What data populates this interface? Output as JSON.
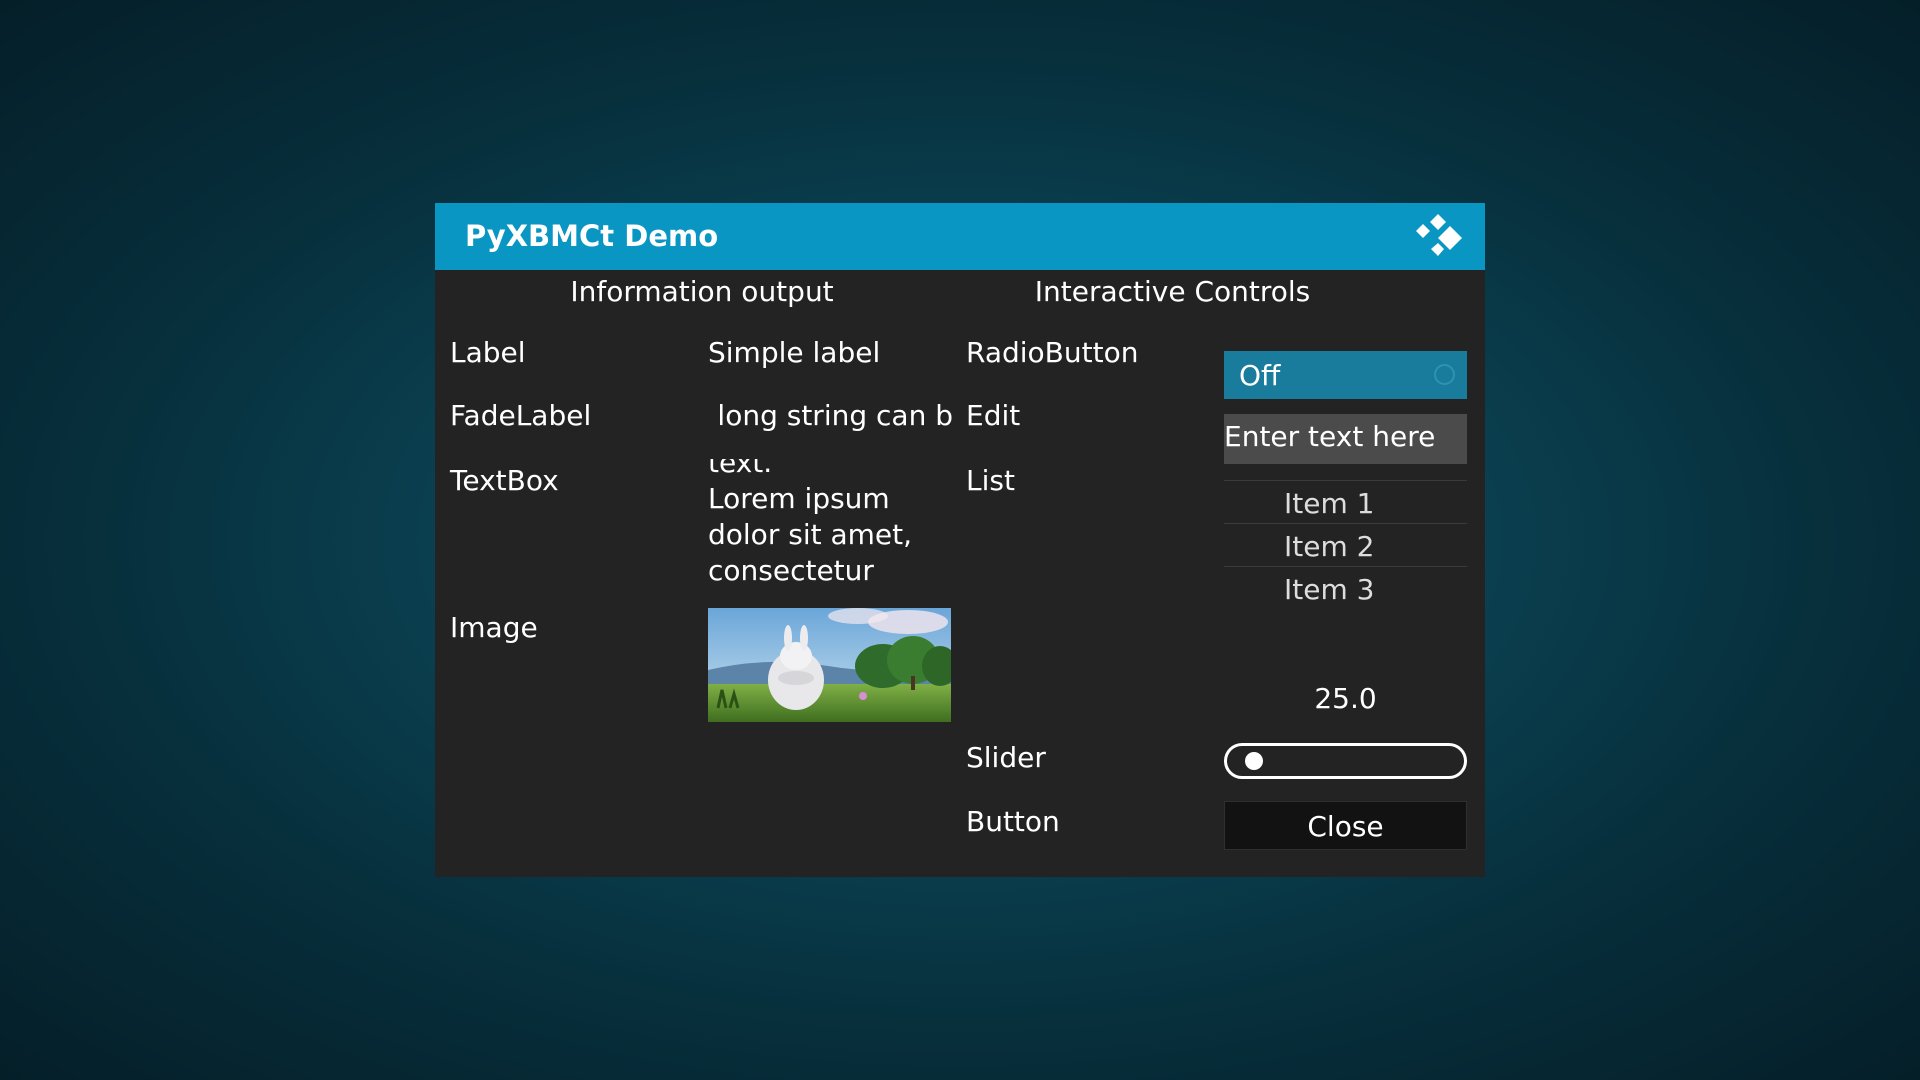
{
  "dialog": {
    "title": "PyXBMCt Demo",
    "logo_icon": "kodi-logo-icon"
  },
  "left_column": {
    "heading": "Information output",
    "rows": {
      "label": {
        "name": "Label",
        "value": "Simple label"
      },
      "fadelabel": {
        "name": "FadeLabel",
        "value": "y long string can b"
      },
      "textbox": {
        "name": "TextBox",
        "top_clipped": "text.",
        "value": "Lorem ipsum dolor sit amet, consectetur"
      },
      "image": {
        "name": "Image"
      }
    }
  },
  "right_column": {
    "heading": "Interactive Controls",
    "radiobutton": {
      "name": "RadioButton",
      "state": "Off"
    },
    "edit": {
      "name": "Edit",
      "text": "Enter text here"
    },
    "list": {
      "name": "List",
      "items": [
        "Item 1",
        "Item 2",
        "Item 3"
      ]
    },
    "slider": {
      "name": "Slider",
      "value_text": "25.0",
      "value": 25,
      "min": 0,
      "max": 100
    },
    "button": {
      "name": "Button",
      "label": "Close"
    }
  },
  "colors": {
    "title_bar": "#0a96c2",
    "dialog_bg": "#232323",
    "radio_bg": "#1a7c9c",
    "edit_bg": "#4b4b4b",
    "button_bg": "#121212"
  }
}
